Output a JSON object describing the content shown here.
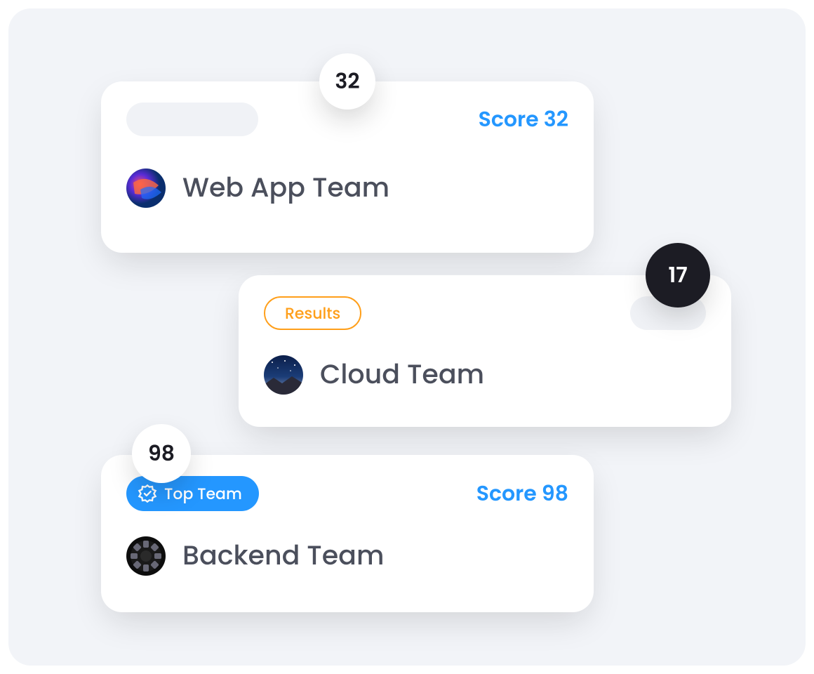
{
  "cards": [
    {
      "badge_value": "32",
      "score_label": "Score 32",
      "team_name": "Web App Team"
    },
    {
      "badge_value": "17",
      "pill_label": "Results",
      "team_name": "Cloud Team"
    },
    {
      "badge_value": "98",
      "pill_label": "Top Team",
      "score_label": "Score 98",
      "team_name": "Backend Team"
    }
  ]
}
